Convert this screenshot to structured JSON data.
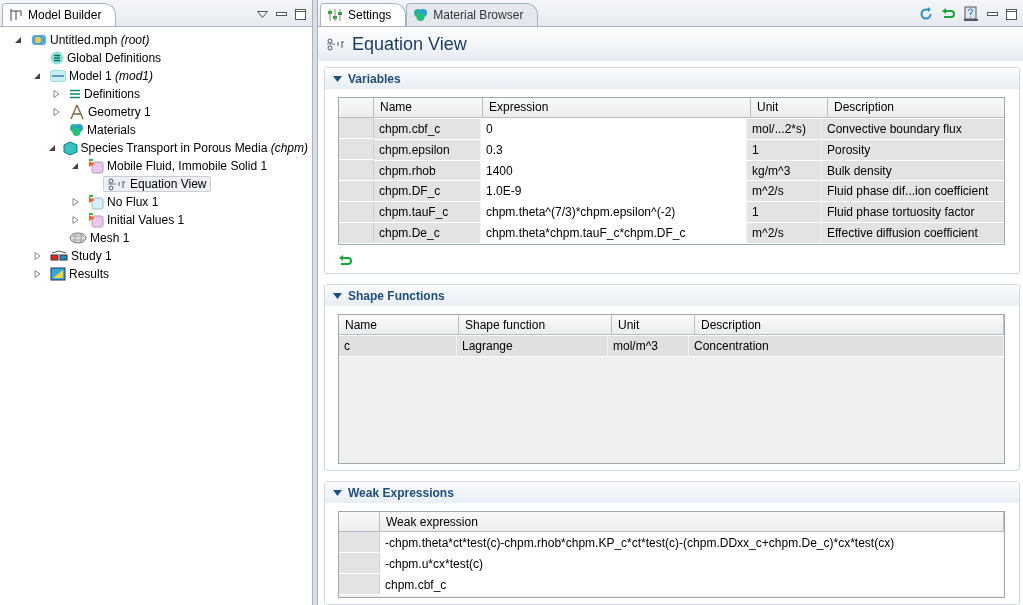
{
  "model_builder": {
    "title": "Model Builder",
    "tree": [
      {
        "label": "Untitled.mph *(root)*",
        "kind": "root",
        "expanded": true,
        "selected": false,
        "children": [
          {
            "label": "Global Definitions",
            "kind": "global",
            "selected": false
          },
          {
            "label": "Model 1 *(mod1)*",
            "kind": "model",
            "expanded": true,
            "selected": false,
            "children": [
              {
                "label": "Definitions",
                "kind": "definitions",
                "expanded": false,
                "selected": false
              },
              {
                "label": "Geometry 1",
                "kind": "geometry",
                "expanded": false,
                "selected": false
              },
              {
                "label": "Materials",
                "kind": "materials",
                "selected": false
              },
              {
                "label": "Species Transport in Porous Media *(chpm)*",
                "kind": "physics",
                "expanded": true,
                "selected": false,
                "children": [
                  {
                    "label": "Mobile Fluid, Immobile Solid 1",
                    "kind": "domain",
                    "expanded": true,
                    "selected": false,
                    "children": [
                      {
                        "label": "Equation View",
                        "kind": "equation",
                        "selected": true
                      }
                    ]
                  },
                  {
                    "label": "No Flux 1",
                    "kind": "boundary",
                    "expanded": false,
                    "selected": false
                  },
                  {
                    "label": "Initial Values 1",
                    "kind": "domain",
                    "expanded": false,
                    "selected": false
                  }
                ]
              },
              {
                "label": "Mesh 1",
                "kind": "mesh",
                "selected": false
              }
            ]
          },
          {
            "label": "Study 1",
            "kind": "study",
            "expanded": false,
            "selected": false
          },
          {
            "label": "Results",
            "kind": "results",
            "expanded": false,
            "selected": false
          }
        ]
      }
    ]
  },
  "tabs": [
    {
      "label": "Settings",
      "kind": "settings",
      "selected": true
    },
    {
      "label": "Material Browser",
      "kind": "materials",
      "selected": false
    }
  ],
  "settings": {
    "title": "Equation View",
    "variables": {
      "title": "Variables",
      "expanded": true,
      "columns": [
        "Name",
        "Expression",
        "Unit",
        "Description"
      ],
      "rows": [
        [
          "chpm.cbf_c",
          "0",
          "mol/...2*s)",
          "Convective boundary flux"
        ],
        [
          "chpm.epsilon",
          "0.3",
          "1",
          "Porosity"
        ],
        [
          "chpm.rhob",
          "1400",
          "kg/m^3",
          "Bulk density"
        ],
        [
          "chpm.DF_c",
          "1.0E-9",
          "m^2/s",
          "Fluid phase dif...ion coefficient"
        ],
        [
          "chpm.tauF_c",
          "chpm.theta^(7/3)*chpm.epsilon^(-2)",
          "1",
          "Fluid phase tortuosity factor"
        ],
        [
          "chpm.De_c",
          "chpm.theta*chpm.tauF_c*chpm.DF_c",
          "m^2/s",
          "Effective diffusion coefficient"
        ]
      ]
    },
    "shape_functions": {
      "title": "Shape Functions",
      "expanded": true,
      "columns": [
        "Name",
        "Shape function",
        "Unit",
        "Description"
      ],
      "rows": [
        {
          "cells": [
            "c",
            "Lagrange",
            "mol/m^3",
            "Concentration"
          ],
          "selected": true
        }
      ]
    },
    "weak_expressions": {
      "title": "Weak Expressions",
      "expanded": true,
      "columns": [
        "Weak expression"
      ],
      "rows": [
        "-chpm.theta*ct*test(c)-chpm.rhob*chpm.KP_c*ct*test(c)-(chpm.DDxx_c+chpm.De_c)*cx*test(cx)",
        "-chpm.u*cx*test(c)",
        "chpm.cbf_c"
      ]
    }
  }
}
